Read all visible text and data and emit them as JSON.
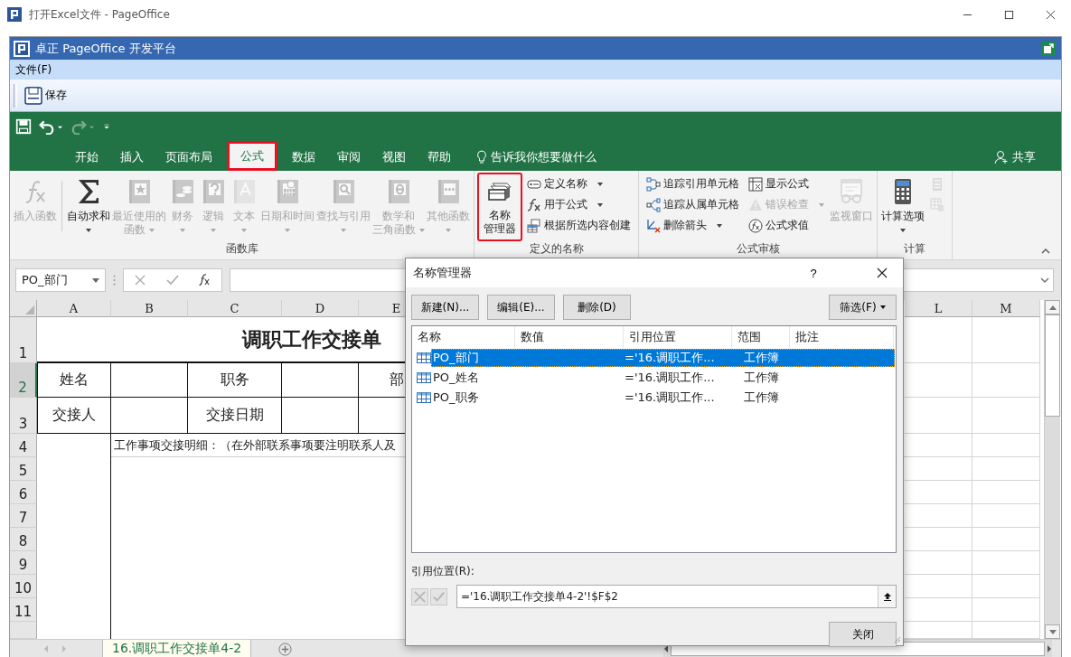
{
  "window": {
    "title": "打开Excel文件 - PageOffice"
  },
  "app_bar": {
    "title": "卓正 PageOffice 开发平台"
  },
  "menu": [
    {
      "label": "文件(F)"
    }
  ],
  "toolbar": [
    {
      "label": "保存"
    }
  ],
  "quick_access": [
    {
      "disabled": false
    },
    {
      "disabled": false
    },
    {
      "disabled": true
    },
    {
      "disabled": false
    }
  ],
  "tabs": [
    {
      "label": "开始",
      "selected": false,
      "highlighted": false
    },
    {
      "label": "插入",
      "selected": false,
      "highlighted": false
    },
    {
      "label": "页面布局",
      "selected": false,
      "highlighted": false
    },
    {
      "label": "公式",
      "selected": true,
      "highlighted": true
    },
    {
      "label": "数据",
      "selected": false,
      "highlighted": false
    },
    {
      "label": "审阅",
      "selected": false,
      "highlighted": false
    },
    {
      "label": "视图",
      "selected": false,
      "highlighted": false
    },
    {
      "label": "帮助",
      "selected": false,
      "highlighted": false
    }
  ],
  "tell_me": "告诉我你想要做什么",
  "share": "共享",
  "ribbon": [
    {
      "title": "函数库",
      "items": [
        {
          "kind": "large",
          "label": "插入函数",
          "disabled": true,
          "dropdown": false,
          "highlighted": false
        },
        {
          "kind": "separator"
        },
        {
          "kind": "large",
          "label": "自动求和",
          "disabled": false,
          "dropdown": true,
          "highlighted": false
        },
        {
          "kind": "large",
          "label": [
            "最近使用的",
            "函数"
          ],
          "disabled": true,
          "dropdown": true,
          "highlighted": false
        },
        {
          "kind": "large",
          "label": "财务",
          "disabled": true,
          "dropdown": true,
          "highlighted": false
        },
        {
          "kind": "large",
          "label": "逻辑",
          "disabled": true,
          "dropdown": true,
          "highlighted": false
        },
        {
          "kind": "large",
          "label": "文本",
          "disabled": true,
          "dropdown": true,
          "highlighted": false
        },
        {
          "kind": "large",
          "label": "日期和时间",
          "disabled": true,
          "dropdown": true,
          "highlighted": false
        },
        {
          "kind": "large",
          "label": "查找与引用",
          "disabled": true,
          "dropdown": true,
          "highlighted": false
        },
        {
          "kind": "large",
          "label": [
            "数学和",
            "三角函数"
          ],
          "disabled": true,
          "dropdown": true,
          "highlighted": false
        },
        {
          "kind": "large",
          "label": "其他函数",
          "disabled": true,
          "dropdown": true,
          "highlighted": false
        }
      ]
    },
    {
      "title": "定义的名称",
      "items": [
        {
          "kind": "large",
          "label": [
            "名称",
            "管理器"
          ],
          "disabled": false,
          "dropdown": false,
          "highlighted": true
        },
        {
          "kind": "stack",
          "items": [
            {
              "label": "定义名称",
              "disabled": false,
              "dropdown": true
            },
            {
              "label": "用于公式",
              "disabled": false,
              "dropdown": true
            },
            {
              "label": "根据所选内容创建",
              "disabled": false,
              "dropdown": false
            }
          ]
        }
      ]
    },
    {
      "title": "公式审核",
      "items": [
        {
          "kind": "stack",
          "items": [
            {
              "label": "追踪引用单元格",
              "disabled": false,
              "dropdown": false
            },
            {
              "label": "追踪从属单元格",
              "disabled": false,
              "dropdown": false
            },
            {
              "label": "删除箭头",
              "disabled": false,
              "dropdown": true
            }
          ]
        },
        {
          "kind": "stack",
          "items": [
            {
              "label": "显示公式",
              "disabled": false,
              "dropdown": false
            },
            {
              "label": "错误检查",
              "disabled": true,
              "dropdown": true
            },
            {
              "label": "公式求值",
              "disabled": false,
              "dropdown": false
            }
          ]
        },
        {
          "kind": "large",
          "label": "监视窗口",
          "disabled": true,
          "dropdown": false,
          "highlighted": false
        }
      ]
    },
    {
      "title": "计算",
      "items": [
        {
          "kind": "large",
          "label": "计算选项",
          "disabled": false,
          "dropdown": true,
          "highlighted": false
        },
        {
          "kind": "stack",
          "items": [
            {
              "disabled": true,
              "dropdown": false
            },
            {
              "disabled": true,
              "dropdown": false
            }
          ]
        }
      ]
    }
  ],
  "sheet": {
    "name_box": "PO_部门",
    "columns": [
      "A",
      "B",
      "C",
      "D",
      "E",
      "L",
      "M"
    ],
    "rows": [
      {
        "header": "1",
        "selected": false,
        "kind": "title",
        "cells": [
          "",
          "",
          "调职工作交接单"
        ]
      },
      {
        "header": "2",
        "selected": true,
        "kind": "form",
        "cells": [
          "姓名",
          "",
          "职务",
          "",
          "部"
        ]
      },
      {
        "header": "3",
        "selected": false,
        "kind": "form",
        "cells": [
          "交接人",
          "",
          "交接日期",
          "",
          ""
        ]
      },
      {
        "header": "4",
        "selected": false,
        "kind": "detail",
        "cells": [
          "",
          "工作事项交接明细：（在外部联系事项要注明联系人及"
        ]
      },
      {
        "header": "5",
        "selected": false,
        "kind": "detail",
        "cells": []
      },
      {
        "header": "6",
        "selected": false,
        "kind": "detail",
        "cells": []
      },
      {
        "header": "7",
        "selected": false,
        "kind": "detail",
        "cells": []
      },
      {
        "header": "8",
        "selected": false,
        "kind": "detail",
        "cells": []
      },
      {
        "header": "9",
        "selected": false,
        "kind": "detail",
        "cells": []
      },
      {
        "header": "10",
        "selected": false,
        "kind": "detail",
        "cells": []
      },
      {
        "header": "11",
        "selected": false,
        "kind": "detail",
        "cells": []
      }
    ],
    "sheet_tabs": [
      {
        "label": "16.调职工作交接单4-2",
        "selected": true
      }
    ]
  },
  "dialog": {
    "title": "名称管理器",
    "help": "?",
    "buttons": [
      {
        "label": "新建(N)..."
      },
      {
        "label": "编辑(E)..."
      },
      {
        "label": "删除(D)"
      }
    ],
    "filter": "筛选(F)",
    "columns": [
      "名称",
      "数值",
      "引用位置",
      "范围",
      "批注"
    ],
    "rows": [
      {
        "name": "PO_部门",
        "refers_to": "='16.调职工作...",
        "scope": "工作簿",
        "selected": true
      },
      {
        "name": "PO_姓名",
        "refers_to": "='16.调职工作...",
        "scope": "工作簿",
        "selected": false
      },
      {
        "name": "PO_职务",
        "refers_to": "='16.调职工作...",
        "scope": "工作簿",
        "selected": false
      }
    ],
    "refers_label": "引用位置(R):",
    "refers_value": "='16.调职工作交接单4-2'!$F$2",
    "close": "关闭"
  }
}
